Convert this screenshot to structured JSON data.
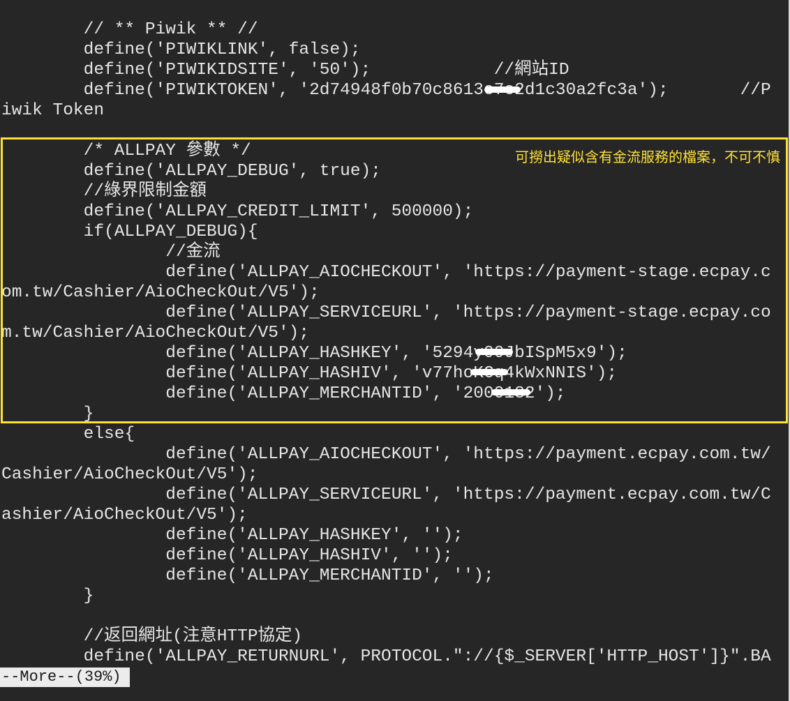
{
  "code_lines": [
    "        // ** Piwik ** //",
    "        define('PIWIKLINK', false);",
    "        define('PIWIKIDSITE', '50');            //網站ID",
    "        define('PIWIKTOKEN', '2d74948f0b70c8613e7e2d1c30a2fc3a');       //P",
    "iwik Token",
    "",
    "        /* ALLPAY 參數 */",
    "        define('ALLPAY_DEBUG', true);",
    "        //綠界限制金額",
    "        define('ALLPAY_CREDIT_LIMIT', 500000);",
    "        if(ALLPAY_DEBUG){",
    "                //金流",
    "                define('ALLPAY_AIOCHECKOUT', 'https://payment-stage.ecpay.c",
    "om.tw/Cashier/AioCheckOut/V5');",
    "                define('ALLPAY_SERVICEURL', 'https://payment-stage.ecpay.co",
    "m.tw/Cashier/AioCheckOut/V5');",
    "                define('ALLPAY_HASHKEY', '5294y00JbISpM5x9');",
    "                define('ALLPAY_HASHIV', 'v77hoKCq4kWxNNIS');",
    "                define('ALLPAY_MERCHANTID', '2000132');",
    "        }",
    "        else{",
    "                define('ALLPAY_AIOCHECKOUT', 'https://payment.ecpay.com.tw/",
    "Cashier/AioCheckOut/V5');",
    "                define('ALLPAY_SERVICEURL', 'https://payment.ecpay.com.tw/C",
    "ashier/AioCheckOut/V5');",
    "                define('ALLPAY_HASHKEY', '');",
    "                define('ALLPAY_HASHIV', '');",
    "                define('ALLPAY_MERCHANTID', '');",
    "        }",
    "",
    "        //返回網址(注意HTTP協定)",
    "        define('ALLPAY_RETURNURL', PROTOCOL.\"://{$_SERVER['HTTP_HOST']}\".BA"
  ],
  "annotation": {
    "text": "可撈出疑似含有金流服務的檔案，不可不慎",
    "color": "#ffe135"
  },
  "pager": {
    "text": "--More--(39%)"
  },
  "colors": {
    "background": "#262626",
    "text": "#e6e6e6",
    "highlight": "#ffe135",
    "redaction": "#ffffff"
  }
}
